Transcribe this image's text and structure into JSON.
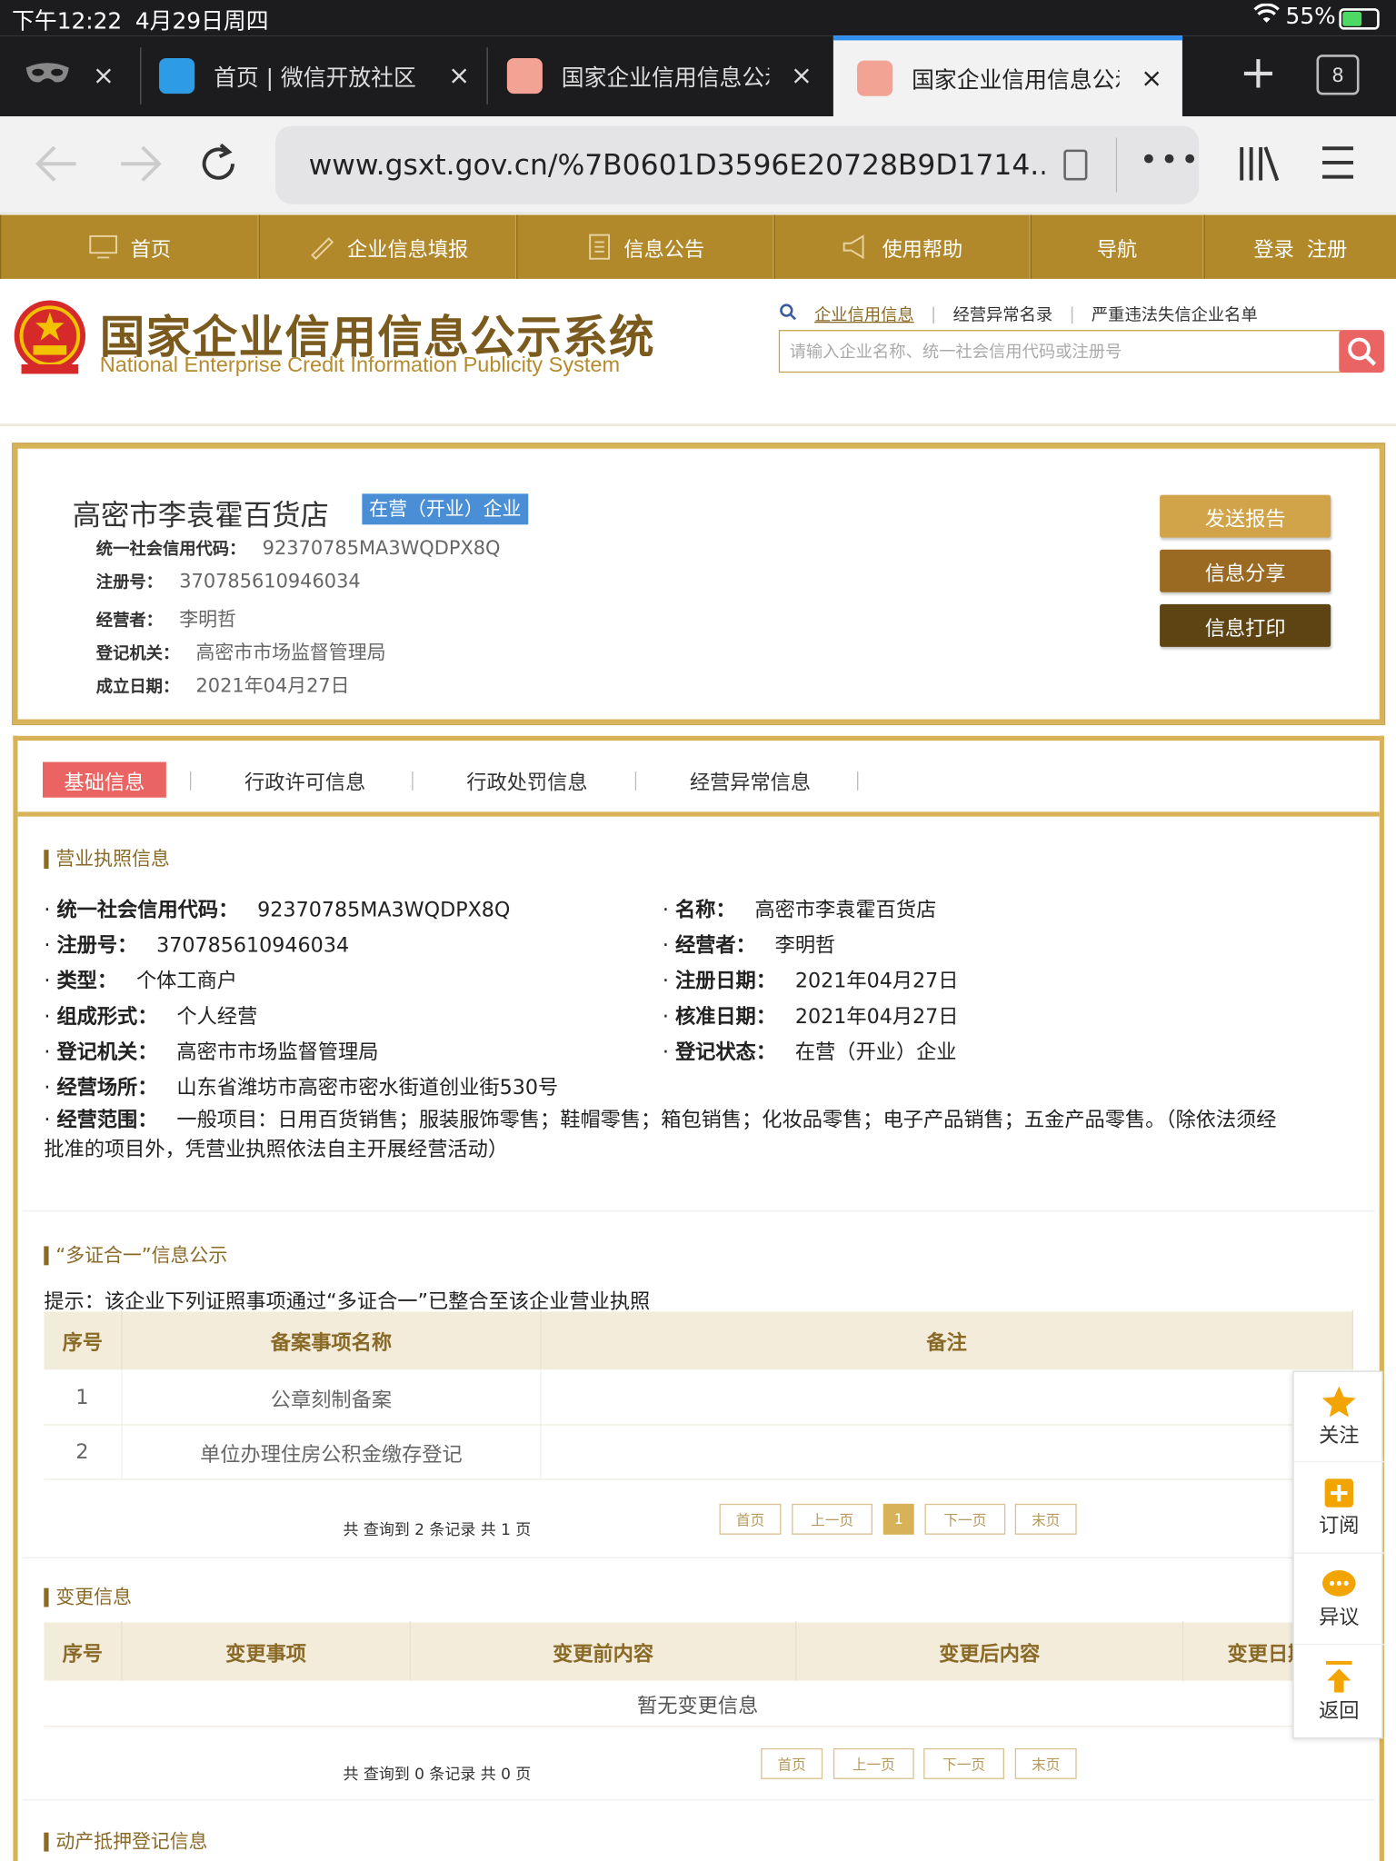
{
  "status": {
    "time": "下午12:22",
    "date": "4月29日周四",
    "battery": "55%"
  },
  "tabs": [
    {
      "title": "",
      "close": "×"
    },
    {
      "title": "首页 | 微信开放社区",
      "close": "×"
    },
    {
      "title": "国家企业信用信息公示",
      "close": "×"
    },
    {
      "title": "国家企业信用信息公示",
      "close": "×"
    }
  ],
  "tab_count": "8",
  "url": "www.gsxt.gov.cn/%7B0601D3596E20728B9D1714...",
  "nav": [
    "首页",
    "企业信息填报",
    "信息公告",
    "使用帮助",
    "导航",
    "登录  注册"
  ],
  "header": {
    "name_cn": "国家企业信用信息公示系统",
    "name_en": "National Enterprise Credit Information Publicity System",
    "links": [
      "企业信用信息",
      "经营异常名录",
      "严重违法失信企业名单"
    ],
    "search_placeholder": "请输入企业名称、统一社会信用代码或注册号"
  },
  "company": {
    "name": "高密市李袁霍百货店",
    "status_badge": "在营（开业）企业",
    "fields": [
      {
        "label": "统一社会信用代码：",
        "value": "92370785MA3WQDPX8Q"
      },
      {
        "label": "注册号：",
        "value": "370785610946034"
      },
      {
        "label": "经营者：",
        "value": "李明哲"
      },
      {
        "label": "登记机关：",
        "value": "高密市市场监督管理局"
      },
      {
        "label": "成立日期：",
        "value": "2021年04月27日"
      }
    ],
    "buttons": [
      "发送报告",
      "信息分享",
      "信息打印"
    ]
  },
  "detail_tabs": [
    "基础信息",
    "行政许可信息",
    "行政处罚信息",
    "经营异常信息"
  ],
  "license": {
    "title": "营业执照信息",
    "left": [
      {
        "label": "统一社会信用代码：",
        "value": "92370785MA3WQDPX8Q"
      },
      {
        "label": "注册号：",
        "value": "370785610946034"
      },
      {
        "label": "类型：",
        "value": "个体工商户"
      },
      {
        "label": "组成形式：",
        "value": "个人经营"
      },
      {
        "label": "登记机关：",
        "value": "高密市市场监督管理局"
      },
      {
        "label": "经营场所：",
        "value": "山东省潍坊市高密市密水街道创业街530号"
      }
    ],
    "right": [
      {
        "label": "名称：",
        "value": "高密市李袁霍百货店"
      },
      {
        "label": "经营者：",
        "value": "李明哲"
      },
      {
        "label": "注册日期：",
        "value": "2021年04月27日"
      },
      {
        "label": "核准日期：",
        "value": "2021年04月27日"
      },
      {
        "label": "登记状态：",
        "value": "在营（开业）企业"
      }
    ],
    "scope_label": "经营范围：",
    "scope_line1": "一般项目：日用百货销售；服装服饰零售；鞋帽零售；箱包销售；化妆品零售；电子产品销售；五金产品零售。（除依法须经",
    "scope_line2": "批准的项目外，凭营业执照依法自主开展经营活动）"
  },
  "multi": {
    "title": "“多证合一”信息公示",
    "hint": "提示：该企业下列证照事项通过“多证合一”已整合至该企业营业执照",
    "headers": [
      "序号",
      "备案事项名称",
      "备注"
    ],
    "rows": [
      [
        "1",
        "公章刻制备案",
        ""
      ],
      [
        "2",
        "单位办理住房公积金缴存登记",
        ""
      ]
    ],
    "summary": "共 查询到 2 条记录 共 1 页",
    "pager": [
      "首页",
      "上一页",
      "1",
      "下一页",
      "末页"
    ]
  },
  "changes": {
    "title": "变更信息",
    "headers": [
      "序号",
      "变更事项",
      "变更前内容",
      "变更后内容",
      "变更日期"
    ],
    "empty": "暂无变更信息",
    "summary": "共 查询到 0 条记录 共 0 页",
    "pager": [
      "首页",
      "上一页",
      "下一页",
      "末页"
    ]
  },
  "pledge_title": "动产抵押登记信息",
  "float": [
    "关注",
    "订阅",
    "异议",
    "返回"
  ],
  "colors": {
    "nav": "#b1892a",
    "accent": "#e96463",
    "badge": "#4a8fd6",
    "gold": "#d8b259"
  }
}
